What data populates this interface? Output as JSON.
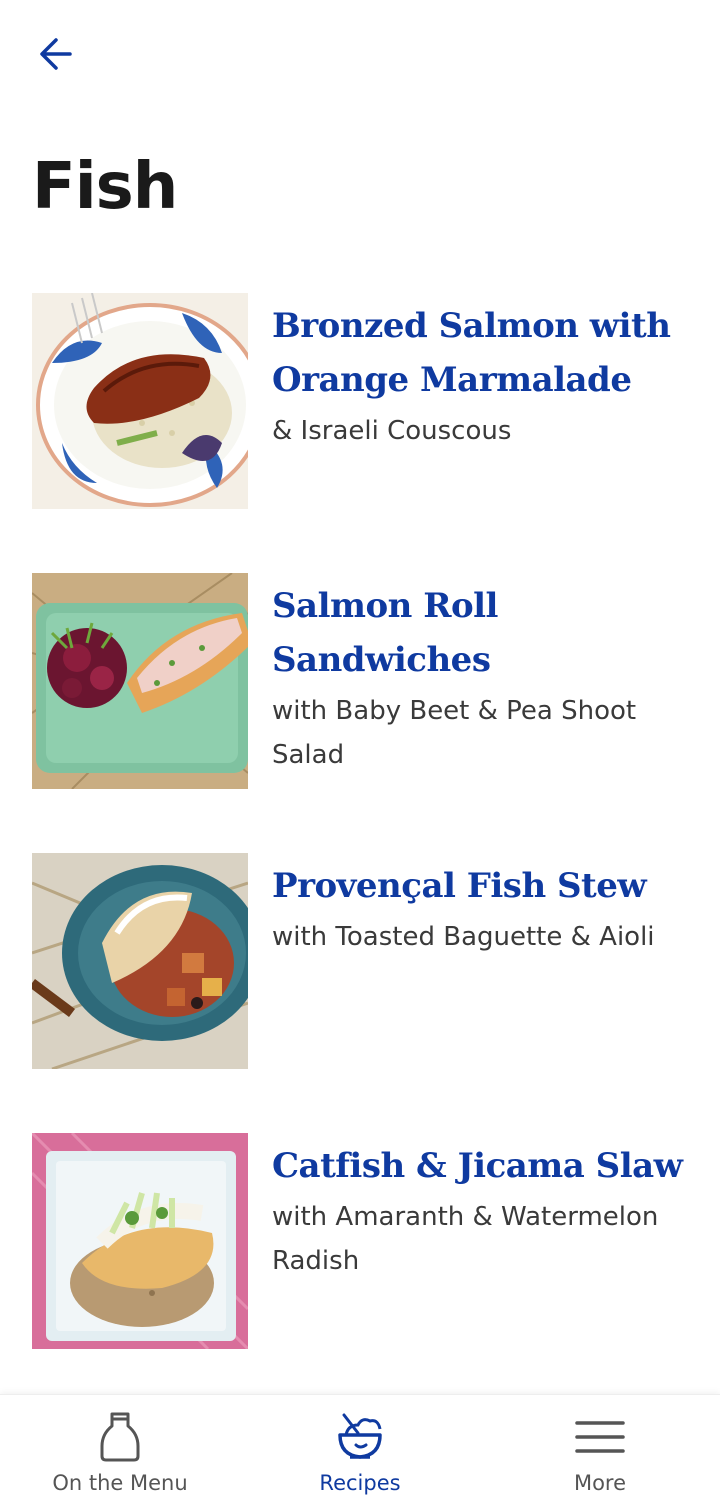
{
  "page": {
    "title": "Fish"
  },
  "colors": {
    "accent": "#0f3aa0",
    "text": "#1a1a1a",
    "muted": "#555555"
  },
  "back_button": {
    "icon": "arrow-left-icon"
  },
  "recipes": [
    {
      "title": "Bronzed Salmon with Orange Marmalade",
      "subtitle": "& Israeli Couscous"
    },
    {
      "title": "Salmon Roll Sandwiches",
      "subtitle": "with Baby Beet & Pea Shoot Salad"
    },
    {
      "title": "Provençal Fish Stew",
      "subtitle": "with Toasted Baguette & Aioli"
    },
    {
      "title": "Catfish & Jicama Slaw",
      "subtitle": "with Amaranth & Watermelon Radish"
    }
  ],
  "bottom_nav": {
    "items": [
      {
        "label": "On the Menu",
        "icon": "bottle-icon",
        "active": false
      },
      {
        "label": "Recipes",
        "icon": "bowl-icon",
        "active": true
      },
      {
        "label": "More",
        "icon": "menu-icon",
        "active": false
      }
    ]
  }
}
